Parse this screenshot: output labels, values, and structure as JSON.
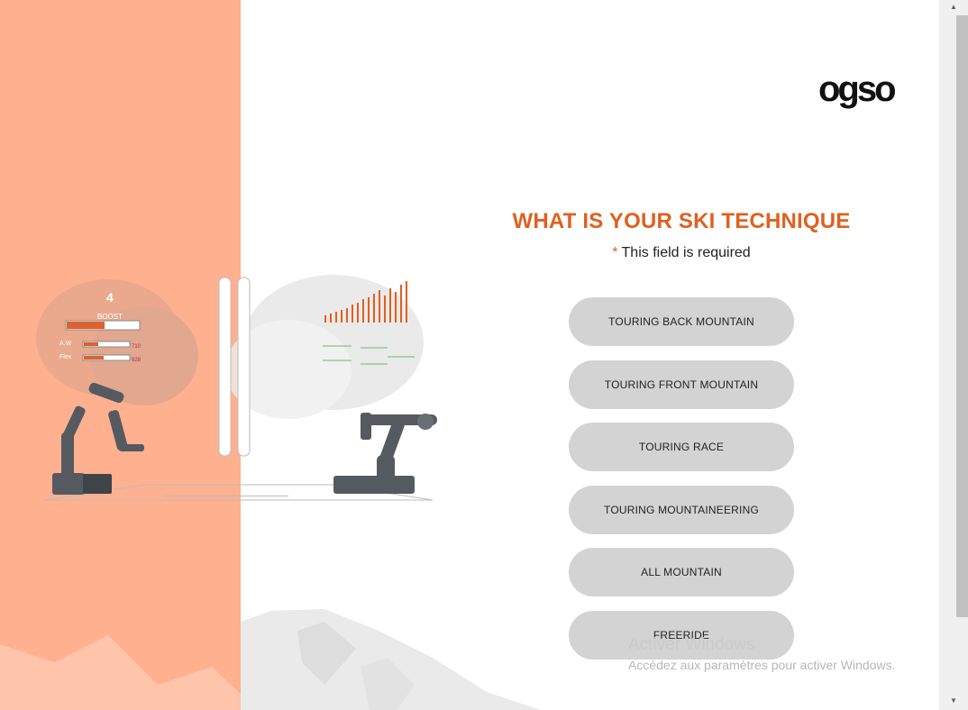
{
  "form": {
    "title": "WHAT IS YOUR SKI TECHNIQUE",
    "required_marker": "*",
    "required_text": "This field is required",
    "options": [
      "TOURING BACK MOUNTAIN",
      "TOURING FRONT MOUNTAIN",
      "TOURING RACE",
      "TOURING MOUNTAINEERING",
      "ALL MOUNTAIN",
      "FREERIDE"
    ]
  },
  "logo": {
    "text": "ogso"
  },
  "illustration": {
    "boost_label": "BOOST",
    "number_label": "4",
    "gauge_labels": [
      "A.W",
      "Flex"
    ],
    "gauge_values": [
      "710",
      "928"
    ]
  },
  "watermark": {
    "title": "Activer Windows",
    "subtitle": "Accédez aux paramètres pour activer Windows."
  },
  "colors": {
    "accent": "#e0601f",
    "panel": "#ffb08e",
    "button": "#d3d3d3"
  },
  "icons": {
    "scroll_up": "triangle-up",
    "scroll_down": "triangle-down"
  }
}
